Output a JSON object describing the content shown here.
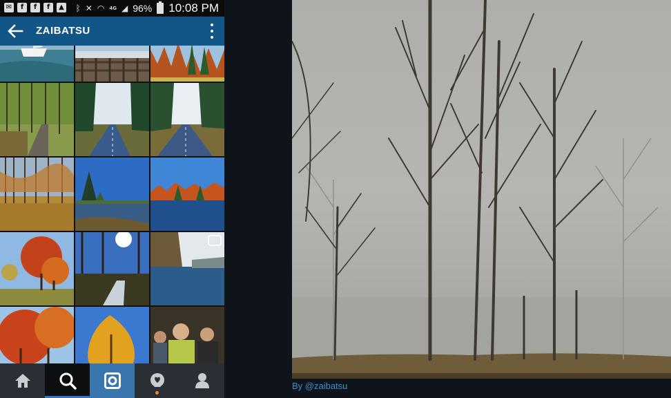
{
  "status_bar": {
    "battery": "96%",
    "time": "10:08 PM",
    "network": "4G"
  },
  "app_bar": {
    "title": "ZAIBATSU",
    "back_icon": "arrow-left-icon",
    "menu_icon": "more-vertical-icon",
    "color": "#125688"
  },
  "grid": {
    "tiles": [
      {
        "scene": "sailboat-lake"
      },
      {
        "scene": "marina-fence"
      },
      {
        "scene": "autumn-treeline"
      },
      {
        "scene": "forest-path"
      },
      {
        "scene": "pine-bike-path"
      },
      {
        "scene": "pine-bike-path-2"
      },
      {
        "scene": "leafy-woods"
      },
      {
        "scene": "pine-pond"
      },
      {
        "scene": "autumn-lake"
      },
      {
        "scene": "red-maples"
      },
      {
        "scene": "sunburst-trees"
      },
      {
        "scene": "river-bank"
      },
      {
        "scene": "red-foliage"
      },
      {
        "scene": "yellow-tree"
      },
      {
        "scene": "crowd-people"
      }
    ]
  },
  "bottom_nav": {
    "items": [
      {
        "icon": "home-icon",
        "active": false
      },
      {
        "icon": "search-icon",
        "active": true
      },
      {
        "icon": "camera-icon",
        "active": false
      },
      {
        "icon": "activity-icon",
        "active": false,
        "notification": true
      },
      {
        "icon": "profile-icon",
        "active": false
      }
    ]
  },
  "viewer": {
    "scene": "foggy-trees",
    "caption": "By @zaibatsu",
    "caption_color": "#3b8fd6"
  }
}
